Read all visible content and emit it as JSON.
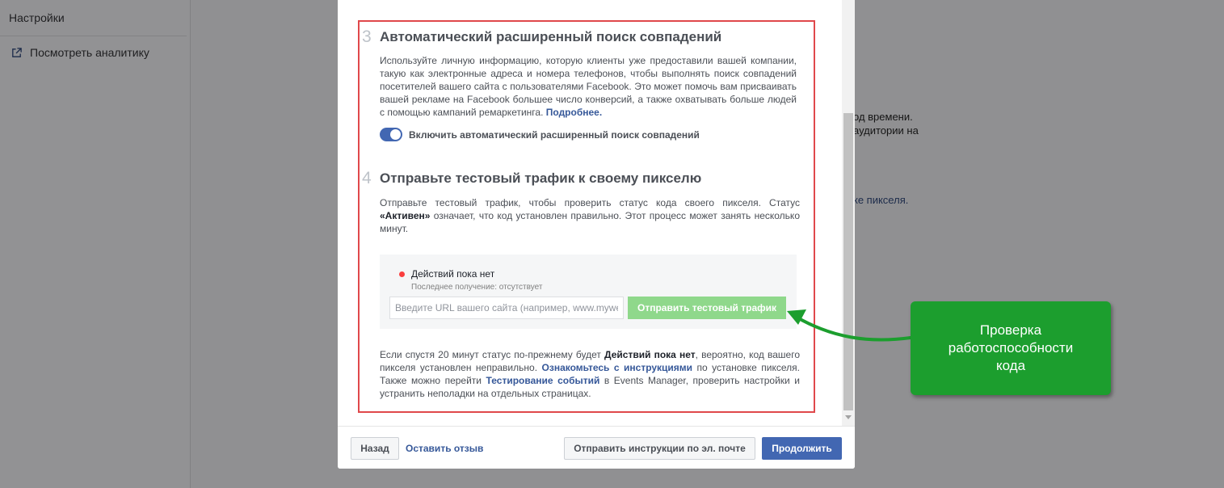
{
  "background": {
    "sidebar": {
      "settings_label": "Настройки",
      "analytics_link": "Посмотреть аналитику"
    },
    "text_fragment_1": "од времени.",
    "text_fragment_2": "аудитории на",
    "text_fragment_3": "ке пикселя."
  },
  "modal": {
    "step3": {
      "number": "3",
      "title": "Автоматический расширенный поиск совпадений",
      "description": "Используйте личную информацию, которую клиенты уже предоставили вашей компании, такую как электронные адреса и номера телефонов, чтобы выполнять поиск совпадений посетителей вашего сайта с пользователями Facebook. Это может помочь вам присваивать вашей рекламе на Facebook большее число конверсий, а также охватывать больше людей с помощью кампаний ремаркетинга.",
      "learn_more": "Подробнее.",
      "toggle_label": "Включить автоматический расширенный поиск совпадений",
      "toggle_on": true
    },
    "step4": {
      "number": "4",
      "title": "Отправьте тестовый трафик к своему пикселю",
      "desc_part1": "Отправьте тестовый трафик, чтобы проверить статус кода своего пикселя. Статус ",
      "desc_bold": "«Активен»",
      "desc_part2": " означает, что код установлен правильно. Этот процесс может занять несколько минут.",
      "status_text": "Действий пока нет",
      "last_received": "Последнее получение: отсутствует",
      "url_placeholder": "Введите URL вашего сайта (например, www.mywebsite.com)",
      "send_button": "Отправить тестовый трафик",
      "note_part1": "Если спустя 20 минут статус по-прежнему будет ",
      "note_bold": "Действий пока нет",
      "note_part2": ", вероятно, код вашего пикселя установлен неправильно. ",
      "note_link1": "Ознакомьтесь с инструкциями",
      "note_part3": " по установке пикселя. Также можно перейти ",
      "note_link2": "Тестирование событий",
      "note_part4": " в Events Manager, проверить настройки и устранить неполадки на отдельных страницах."
    },
    "footer": {
      "back_button": "Назад",
      "feedback_link": "Оставить отзыв",
      "email_button": "Отправить инструкции по эл. почте",
      "continue_button": "Продолжить"
    }
  },
  "callout": {
    "text": "Проверка работоспособности кода"
  },
  "colors": {
    "facebook_blue": "#4267b2",
    "link_blue": "#365899",
    "send_button_green": "#8fd88b",
    "callout_green": "#1c9e2e",
    "highlight_red": "#e0484b",
    "status_red": "#fa3e3e"
  }
}
